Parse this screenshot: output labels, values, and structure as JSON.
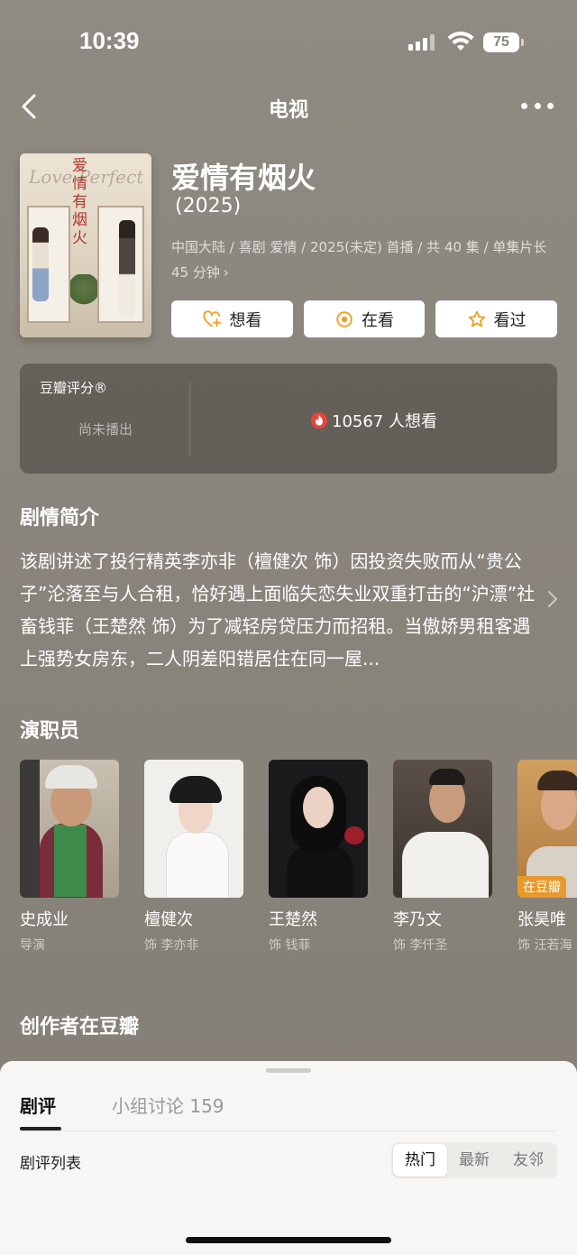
{
  "status": {
    "time": "10:39",
    "battery": "75"
  },
  "nav": {
    "title": "电视"
  },
  "show": {
    "title": "爱情有烟火",
    "year": "(2025)",
    "meta_line1": "中国大陆 / 喜剧 爱情 / 2025(未定) 首播 / 共 40 集 / 单集片长",
    "meta_line2": "45 分钟",
    "poster_title": "爱情有烟火",
    "poster_script": "Love Perfect"
  },
  "actions": {
    "want": "想看",
    "watching": "在看",
    "watched": "看过"
  },
  "rating": {
    "label": "豆瓣评分®",
    "empty": "尚未播出",
    "wish_count": "10567 人想看"
  },
  "synopsis": {
    "heading": "剧情简介",
    "text": "该剧讲述了投行精英李亦非（檀健次 饰）因投资失败而从“贵公子”沦落至与人合租，恰好遇上面临失恋失业双重打击的“沪漂”社畜钱菲（王楚然 饰）为了减轻房贷压力而招租。当傲娇男租客遇上强势女房东，二人阴差阳错居住在同一屋..."
  },
  "cast": {
    "heading": "演职员",
    "members": [
      {
        "name": "史成业",
        "role": "导演"
      },
      {
        "name": "檀健次",
        "role": "饰 李亦非"
      },
      {
        "name": "王楚然",
        "role": "饰 钱菲"
      },
      {
        "name": "李乃文",
        "role": "饰 李仟圣"
      },
      {
        "name": "张昊唯",
        "role": "饰 汪若海",
        "badge": "在豆瓣"
      }
    ]
  },
  "creators": {
    "heading": "创作者在豆瓣"
  },
  "sheet": {
    "tab_reviews": "剧评",
    "tab_groups": "小组讨论 159",
    "list_label": "剧评列表",
    "sort": [
      "热门",
      "最新",
      "友邻"
    ]
  },
  "colors": {
    "accent_orange": "#f0a020",
    "hot_red": "#e8453c",
    "badge": "#e79a2b"
  }
}
